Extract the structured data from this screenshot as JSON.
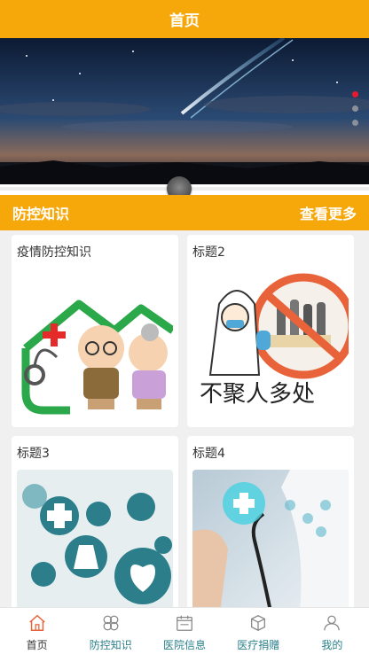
{
  "header": {
    "title": "首页"
  },
  "carousel": {
    "slide_count": 3,
    "active_index": 0,
    "active_color": "#e8192c"
  },
  "section": {
    "title": "防控知识",
    "more_label": "查看更多"
  },
  "cards": [
    {
      "title": "疫情防控知识",
      "image": "elderly-couple-health-illustration"
    },
    {
      "title": "标题2",
      "image": "no-gathering-illustration",
      "image_text": "不聚人多处"
    },
    {
      "title": "标题3",
      "image": "medical-icons-collage"
    },
    {
      "title": "标题4",
      "image": "doctor-stethoscope-photo"
    }
  ],
  "tabs": [
    {
      "label": "首页",
      "icon": "home-icon",
      "active": true
    },
    {
      "label": "防控知识",
      "icon": "clover-icon",
      "active": false
    },
    {
      "label": "医院信息",
      "icon": "calendar-icon",
      "active": false
    },
    {
      "label": "医疗捐赠",
      "icon": "box-icon",
      "active": false
    },
    {
      "label": "我的",
      "icon": "user-icon",
      "active": false
    }
  ],
  "colors": {
    "accent": "#f6a80b",
    "tab_text": "#2a7f8a"
  }
}
